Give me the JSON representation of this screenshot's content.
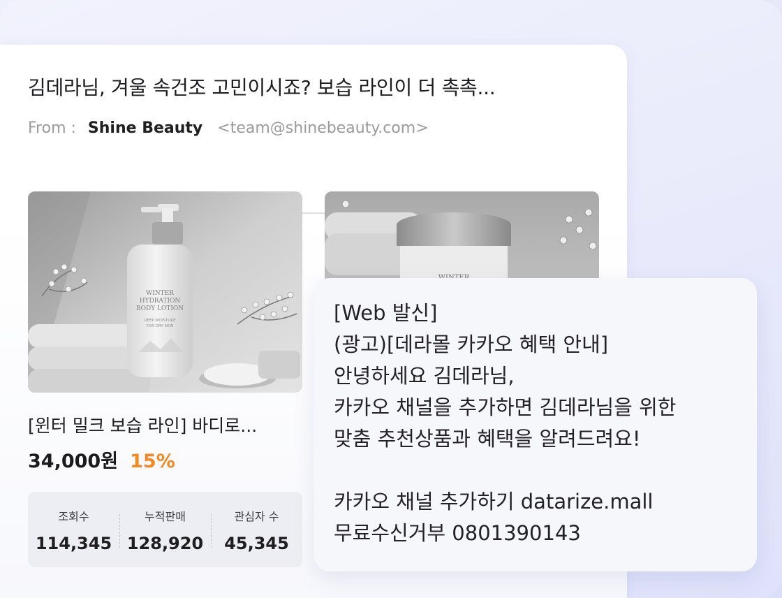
{
  "email": {
    "subject": "김데라님, 겨울 속건조 고민이시죠? 보습 라인이 더 촉촉...",
    "from_label": "From :",
    "from_name": "Shine Beauty",
    "from_email": "<team@shinebeauty.com>"
  },
  "products": [
    {
      "name": "[윈터 밀크 보습 라인] 바디로...",
      "price": "34,000원",
      "discount": "15%",
      "bottle_label": "WINTER HYDRATION BODY LOTION",
      "bottle_sublabel": "DEEP MOISTURE FOR DRY SKIN"
    },
    {
      "jar_label": "WINTER"
    }
  ],
  "stats": [
    {
      "label": "조회수",
      "value": "114,345"
    },
    {
      "label": "누적판매",
      "value": "128,920"
    },
    {
      "label": "관심자 수",
      "value": "45,345"
    }
  ],
  "message": {
    "text": "[Web 발신]\n(광고)[데라몰 카카오 혜택 안내]\n안녕하세요 김데라님,\n카카오 채널을 추가하면 김데라님을 위한\n맞춤 추천상품과 혜택을 알려드려요!\n\n카카오 채널 추가하기 datarize.mall\n무료수신거부 0801390143"
  }
}
